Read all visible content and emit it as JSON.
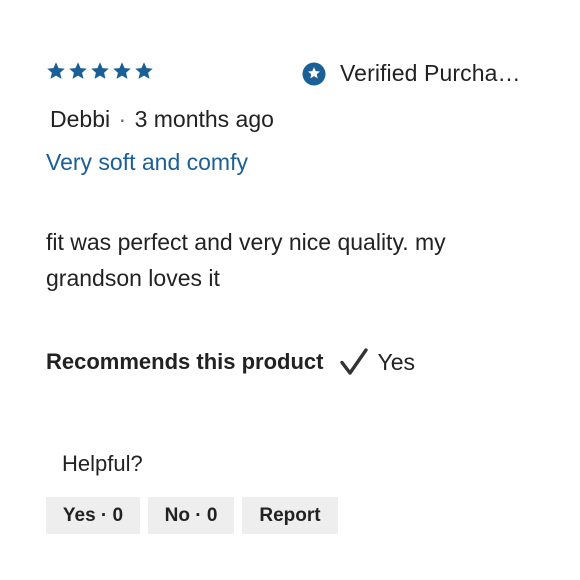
{
  "review": {
    "rating": 5,
    "rating_max": 5,
    "verified_label": "Verified Purcha…",
    "author": "Debbi",
    "separator": "·",
    "time_ago": "3 months ago",
    "title": "Very soft and comfy",
    "body": "fit was perfect and very nice quality. my grandson loves it",
    "recommends_label": "Recommends this product",
    "recommends_value": "Yes"
  },
  "feedback": {
    "helpful_label": "Helpful?",
    "yes_button": "Yes · 0",
    "no_button": "No · 0",
    "report_button": "Report"
  },
  "colors": {
    "star": "#1a5f96",
    "verified_badge": "#1a5f96",
    "title_link": "#1a5f96",
    "button_bg": "#eeeeee",
    "text": "#222222"
  },
  "icons": {
    "star": "star-icon",
    "verified": "verified-badge-icon",
    "check": "checkmark-icon"
  }
}
